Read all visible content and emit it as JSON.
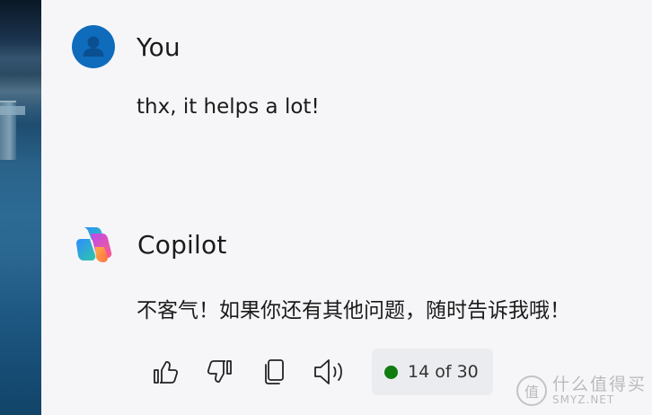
{
  "messages": [
    {
      "author": "You",
      "avatar_icon": "person-icon",
      "text": "thx, it helps a lot!"
    },
    {
      "author": "Copilot",
      "avatar_icon": "copilot-logo-icon",
      "text": "不客气！如果你还有其他问题，随时告诉我哦！"
    }
  ],
  "actions": {
    "icons": [
      "thumbs-up-icon",
      "thumbs-down-icon",
      "copy-icon",
      "read-aloud-icon"
    ],
    "pager_text": "14 of 30",
    "status_color": "#107c10"
  },
  "watermark": {
    "icon_glyph": "值",
    "text_cn": "什么值得买",
    "text_en": "SMYZ.NET"
  },
  "colors": {
    "avatar_bg": "#0f6cbd",
    "background": "#f6f6f9"
  }
}
